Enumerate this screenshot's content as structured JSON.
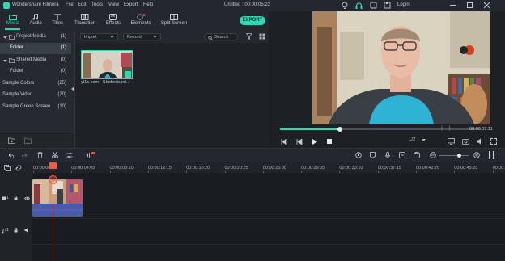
{
  "app": {
    "name": "Wondershare Filmora",
    "title": "Untitled : 00:00:05:22"
  },
  "menu": [
    "File",
    "Edit",
    "Tools",
    "View",
    "Export",
    "Help"
  ],
  "titlebar": {
    "login": "Login"
  },
  "toolbar": {
    "tabs": [
      "Media",
      "Audio",
      "Titles",
      "Transition",
      "Effects",
      "Elements",
      "Split Screen"
    ],
    "export_label": "EXPORT"
  },
  "sidebar": {
    "items": [
      {
        "label": "Project Media",
        "count": "(1)"
      },
      {
        "label": "Folder",
        "count": "(1)"
      },
      {
        "label": "Shared Media",
        "count": "(0)"
      },
      {
        "label": "Folder",
        "count": "(0)"
      },
      {
        "label": "Sample Colors",
        "count": "(25)"
      },
      {
        "label": "Sample Video",
        "count": "(20)"
      },
      {
        "label": "Sample Green Screen",
        "count": "(10)"
      }
    ]
  },
  "media": {
    "import_label": "Import",
    "record_label": "Record",
    "search_placeholder": "Search",
    "clip_name": "yt1s.com - Students int..."
  },
  "preview": {
    "brackets": "{ }",
    "time": "00:00:02:11",
    "quality": "1/2",
    "progress": 0.3
  },
  "timeline": {
    "ruler": [
      "00:00:00:00",
      "00:00:04:05",
      "00:00:08:10",
      "00:00:12:15",
      "00:00:16:20",
      "00:00:20:25",
      "00:00:25:00",
      "00:00:29:05",
      "00:00:33:10",
      "00:00:37:15",
      "00:00:41:20",
      "00:00:45:25",
      "00:00:50:00"
    ],
    "video_track": "1",
    "audio_track": "1"
  },
  "colors": {
    "accent": "#2ed8b6",
    "playhead": "#f05a4a",
    "clip": "#4a5aa8"
  }
}
